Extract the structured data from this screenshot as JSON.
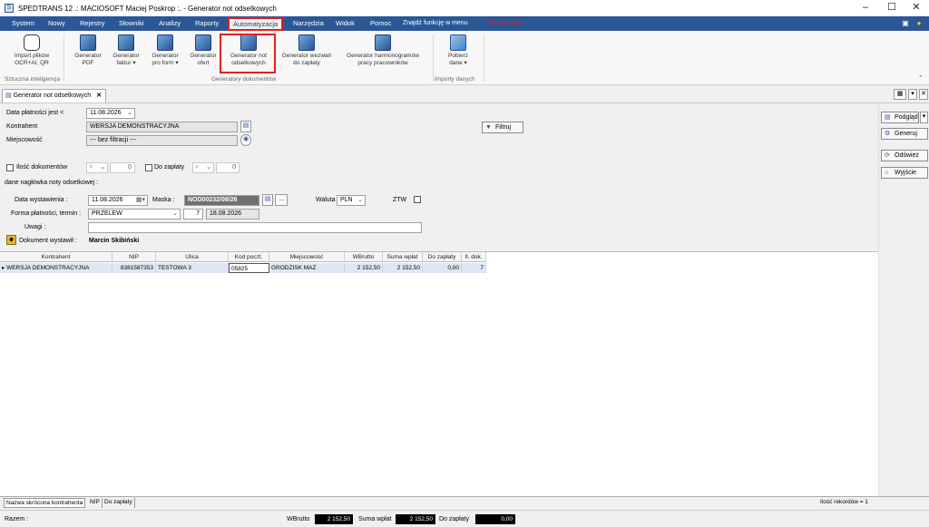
{
  "window": {
    "title": "SPEDTRANS 12 .: MACIOSOFT Maciej Poskrop :. - Generator not odsetkowych",
    "app_icon": "S"
  },
  "menu": {
    "items": [
      "System",
      "Nowy",
      "Rejestry",
      "Słowniki",
      "Analizy",
      "Raporty",
      "Automatyzacja",
      "Narzędzia",
      "Widok",
      "Pomoc"
    ],
    "find_function": "Znajdź funkcję w menu",
    "red_hint": "Rozliczenia"
  },
  "ribbon": {
    "buttons": [
      {
        "l1": "Import plików",
        "l2": "OCR+AI, QR",
        "icon": "ai-icon"
      },
      {
        "l1": "Generator",
        "l2": "PDF",
        "icon": "gear-doc-icon"
      },
      {
        "l1": "Generator",
        "l2": "faktur ▾",
        "icon": "gear-doc-icon"
      },
      {
        "l1": "Generator",
        "l2": "pro form ▾",
        "icon": "gear-doc-icon"
      },
      {
        "l1": "Generator",
        "l2": "ofert",
        "icon": "gear-doc-icon"
      },
      {
        "l1": "Generator not",
        "l2": "odsetkowych",
        "icon": "gear-doc-icon"
      },
      {
        "l1": "Generator wezwań",
        "l2": "do zapłaty",
        "icon": "gear-doc-icon"
      },
      {
        "l1": "Generator harmonogramów",
        "l2": "pracy pracowników",
        "icon": "gear-doc-icon"
      },
      {
        "l1": "Pobierz",
        "l2": "dane ▾",
        "icon": "download-icon"
      }
    ],
    "groups": [
      "Sztuczna inteligencja",
      "Generatory dokumentów",
      "Importy danych"
    ]
  },
  "tab": {
    "label": "Generator not odsetkowych"
  },
  "filters": {
    "due_date_label": "Data płatności jest <",
    "due_date_value": "11.08.2026",
    "contractor_label": "Kontrahent",
    "contractor_value": "WERSJA DEMONSTRACYJNA",
    "city_label": "Miejscowość",
    "city_value": "--- bez filtracji ---",
    "doc_count_label": "Ilość dokumentów",
    "doc_count_op": ">",
    "doc_count_value": "0",
    "to_pay_label": "Do zapłaty",
    "to_pay_op": ">",
    "to_pay_value": "0",
    "filter_btn": "Filtruj"
  },
  "header": {
    "section_label": "dane nagłówka noty odsetkowej :",
    "issue_date_label": "Data wystawienia :",
    "issue_date_value": "11.08.2026",
    "mask_label": "Maska :",
    "mask_value": "NOD00232/08/26",
    "mask_more": "...",
    "currency_label": "Waluta",
    "currency_value": "PLN",
    "ztw_label": "ZTW",
    "payment_label": "Forma płatności, termin :",
    "payment_value": "PRZELEW",
    "term_days": "7",
    "term_date": "18.08.2026",
    "notes_label": "Uwagi :",
    "notes_value": "",
    "issued_by_label": "Dokument wystawił :",
    "issued_by_value": "Marcin Skibiński"
  },
  "grid": {
    "columns": [
      "Kontrahent",
      "NIP",
      "Ulica",
      "Kod poczt.",
      "Miejscowość",
      "WBrutto",
      "Suma wpłat",
      "Do zapłaty",
      "Il. dok."
    ],
    "rows": [
      [
        "WERSJA DEMONSTRACYJNA",
        "8381587353",
        "TESTOWA 3",
        "05825",
        "GRODZISK MAZ",
        "2 152,50",
        "2 152,50",
        "0,00",
        "7"
      ]
    ]
  },
  "side_buttons": {
    "preview": "Podgląd",
    "generate": "Generuj",
    "refresh": "Odśwież",
    "exit": "Wyjście"
  },
  "footer": {
    "tabs": [
      "Nazwa skrócona kontrahenta",
      "NIP",
      "Do zapłaty"
    ],
    "record_count": "Ilość rekordów = 1",
    "sum_label": "Razem :",
    "gross_label": "WBrutto",
    "gross_value": "2 152,50",
    "paid_label": "Suma wpłat",
    "paid_value": "2 152,50",
    "topay_label": "Do zapłaty",
    "topay_value": "0,00"
  },
  "colors": {
    "brand": "#2b5797",
    "highlight": "#e32020",
    "selection": "#dde8f5"
  }
}
